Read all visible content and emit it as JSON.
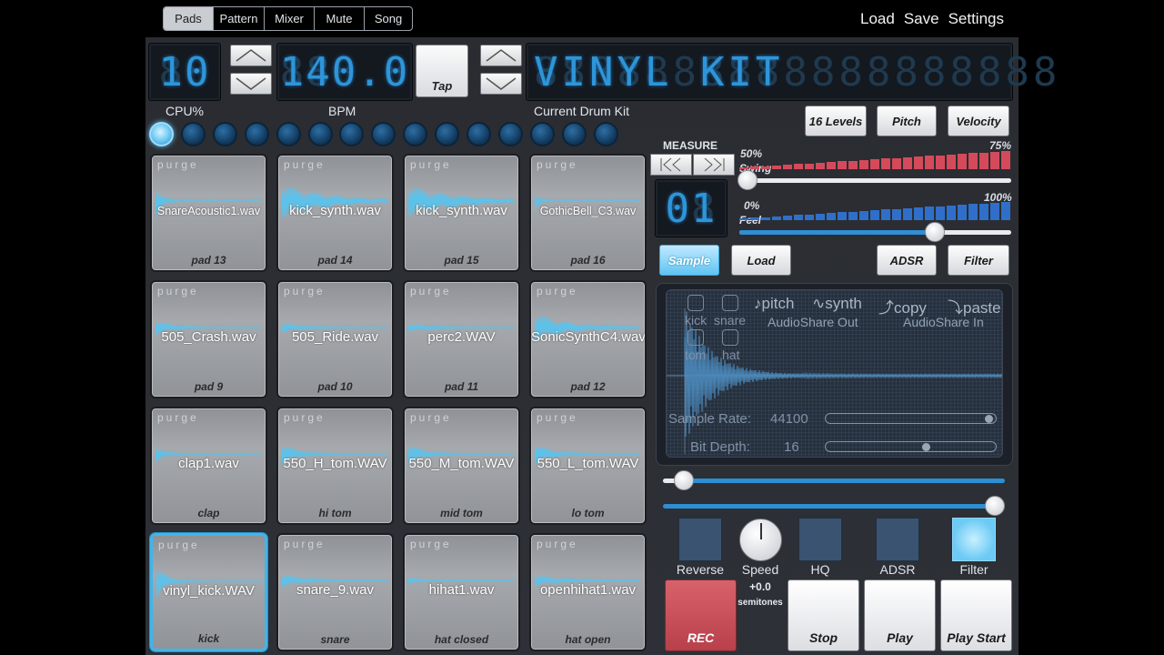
{
  "tabs": [
    "Pads",
    "Pattern",
    "Mixer",
    "Mute",
    "Song"
  ],
  "top_menu": {
    "load": "Load",
    "save": "Save",
    "settings": "Settings"
  },
  "displays": {
    "cpu_value": "10",
    "cpu_label": "CPU%",
    "bpm_value": "140.0",
    "bpm_label": "BPM",
    "tap": "Tap",
    "kit_name": "VINYL KIT",
    "kit_label": "Current Drum Kit"
  },
  "leds": {
    "count": 15,
    "active_index": 0
  },
  "pads": [
    {
      "file": "SnareAcoustic1.wav",
      "name": "pad 13",
      "purge": "purge"
    },
    {
      "file": "kick_synth.wav",
      "name": "pad 14",
      "purge": "purge"
    },
    {
      "file": "kick_synth.wav",
      "name": "pad 15",
      "purge": "purge"
    },
    {
      "file": "GothicBell_C3.wav",
      "name": "pad 16",
      "purge": "purge"
    },
    {
      "file": "505_Crash.wav",
      "name": "pad 9",
      "purge": "purge"
    },
    {
      "file": "505_Ride.wav",
      "name": "pad 10",
      "purge": "purge"
    },
    {
      "file": "perc2.WAV",
      "name": "pad 11",
      "purge": "purge"
    },
    {
      "file": "SonicSynthC4.wav",
      "name": "pad 12",
      "purge": "purge"
    },
    {
      "file": "clap1.wav",
      "name": "clap",
      "purge": "purge"
    },
    {
      "file": "550_H_tom.WAV",
      "name": "hi tom",
      "purge": "purge"
    },
    {
      "file": "550_M_tom.WAV",
      "name": "mid tom",
      "purge": "purge"
    },
    {
      "file": "550_L_tom.WAV",
      "name": "lo tom",
      "purge": "purge"
    },
    {
      "file": "vinyl_kick.WAV",
      "name": "kick",
      "purge": "purge"
    },
    {
      "file": "snare_9.wav",
      "name": "snare",
      "purge": "purge"
    },
    {
      "file": "hihat1.wav",
      "name": "hat closed",
      "purge": "purge"
    },
    {
      "file": "openhihat1.wav",
      "name": "hat open",
      "purge": "purge"
    }
  ],
  "selected_pad": 12,
  "mode_buttons": {
    "levels": "16 Levels",
    "pitch": "Pitch",
    "velocity": "Velocity"
  },
  "measure": {
    "label": "MEASURE",
    "value": "01"
  },
  "swing": {
    "label": "Swing",
    "min": "50%",
    "max": "75%",
    "value": 0.0
  },
  "feel": {
    "label": "Feel",
    "min": "0%",
    "max": "100%",
    "value": 0.72
  },
  "sample_buttons": {
    "sample": "Sample",
    "load": "Load",
    "adsr": "ADSR",
    "filter": "Filter"
  },
  "editor": {
    "kick": "kick",
    "snare": "snare",
    "tom": "tom",
    "hat": "hat",
    "pitch": "pitch",
    "synth": "synth",
    "copy": "copy",
    "paste": "paste",
    "audioshare_out": "AudioShare Out",
    "audioshare_in": "AudioShare In",
    "sample_rate_label": "Sample Rate:",
    "sample_rate_value": "44100",
    "bit_depth_label": "Bit Depth:",
    "bit_depth_value": "16"
  },
  "range": {
    "start": 0.06,
    "end": 1.0
  },
  "fx": {
    "reverse": "Reverse",
    "speed": "Speed",
    "hq": "HQ",
    "adsr": "ADSR",
    "filter": "Filter"
  },
  "speed": {
    "value": "+0.0",
    "unit": "semitones"
  },
  "transport": {
    "rec": "REC",
    "stop": "Stop",
    "play": "Play",
    "play_start": "Play Start"
  },
  "colors": {
    "accent": "#3fb5ec",
    "lcd_text": "#2e95d8",
    "swing_bar": "#d44a5a",
    "feel_bar": "#2f6fc9",
    "rec": "#c44b55"
  }
}
